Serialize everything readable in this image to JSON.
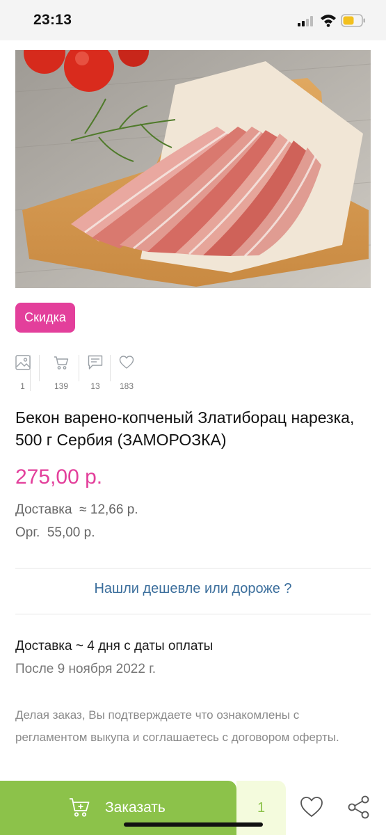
{
  "status_bar": {
    "time": "23:13"
  },
  "product": {
    "badge": "Скидка",
    "title": "Бекон варено-копченый Златиборац нарезка, 500 г Сербия (ЗАМОРОЗКА)",
    "price": "275,00 р.",
    "delivery_label": "Доставка",
    "delivery_value": "≈ 12,66 р.",
    "org_label": "Орг.",
    "org_value": "55,00 р."
  },
  "stats": [
    {
      "icon": "image-icon",
      "count": "1"
    },
    {
      "icon": "cart-icon",
      "count": "139"
    },
    {
      "icon": "comment-icon",
      "count": "13"
    },
    {
      "icon": "heart-icon",
      "count": "183"
    }
  ],
  "cheaper_link": "Нашли дешевле или дороже ?",
  "shipping": {
    "days": "Доставка ~ 4 дня с даты оплаты",
    "date": "После 9 ноября 2022 г."
  },
  "disclaimer": "Делая заказ, Вы подтверждаете что ознакомлены с регламентом выкупа и соглашаетесь с договором оферты.",
  "bottom_bar": {
    "order_label": "Заказать",
    "quantity": "1"
  },
  "colors": {
    "accent_pink": "#e33f9b",
    "order_green": "#8cc24a",
    "link_blue": "#3b6e9c"
  }
}
